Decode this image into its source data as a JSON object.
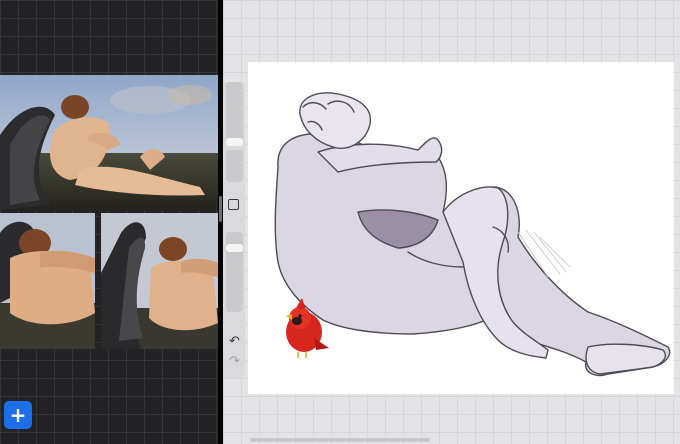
{
  "colors": {
    "left_bg": "#232325",
    "canvas_bg": "#e4e4e6",
    "accent": "#1d6fe8"
  },
  "left_pane": {
    "references": [
      {
        "name": "painting-full"
      },
      {
        "name": "painting-crop-left"
      },
      {
        "name": "painting-crop-wing"
      }
    ],
    "add_button": {
      "icon": "plus-icon",
      "glyph": "+"
    }
  },
  "sidebar": {
    "brush_size_icon": "slider",
    "opacity_icon": "slider",
    "modify_icon": "square-icon",
    "undo": {
      "icon": "undo-icon",
      "glyph": "↶"
    },
    "redo": {
      "icon": "redo-icon",
      "glyph": "↷"
    }
  }
}
